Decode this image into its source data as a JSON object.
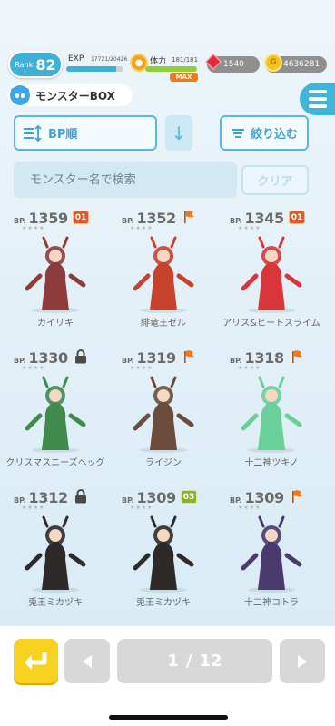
{
  "status": {
    "rank_label": "Rank",
    "rank_value": "82",
    "exp_label": "EXP",
    "exp_value": "17721/20426",
    "exp_progress": 0.87,
    "stamina_label": "体力",
    "stamina_value": "181/181",
    "stamina_progress": 1.0,
    "stamina_max_tag": "MAX",
    "gems": "1540",
    "coins": "4636281"
  },
  "header": {
    "title": "モンスターBOX",
    "menu_icon": "hamburger-icon"
  },
  "controls": {
    "sort_label": "BP順",
    "sort_direction_icon": "arrow-down-icon",
    "filter_label": "絞り込む",
    "search_placeholder": "モンスター名で検索",
    "clear_label": "クリア"
  },
  "monsters": [
    {
      "bp_label": "BP.",
      "bp": "1359",
      "badge": "01",
      "badge_type": "red",
      "name": "カイリキ",
      "color": "#8e3b3b"
    },
    {
      "bp_label": "BP.",
      "bp": "1352",
      "badge_type": "flag",
      "name": "緋竜王ゼル",
      "color": "#c6422c"
    },
    {
      "bp_label": "BP.",
      "bp": "1345",
      "badge": "01",
      "badge_type": "red",
      "name": "アリス&ヒートスライム",
      "color": "#d8363b"
    },
    {
      "bp_label": "BP.",
      "bp": "1330",
      "badge_type": "lock",
      "name": "クリスマスニーズヘッグ",
      "color": "#3f8a4c"
    },
    {
      "bp_label": "BP.",
      "bp": "1319",
      "badge_type": "flag",
      "name": "ライジン",
      "color": "#6b4c3d"
    },
    {
      "bp_label": "BP.",
      "bp": "1318",
      "badge_type": "flag",
      "name": "十二神ツキノ",
      "color": "#6bcf9a"
    },
    {
      "bp_label": "BP.",
      "bp": "1312",
      "badge_type": "lock",
      "name": "兎王ミカヅキ",
      "color": "#2f2a2a"
    },
    {
      "bp_label": "BP.",
      "bp": "1309",
      "badge": "03",
      "badge_type": "green",
      "name": "兎王ミカヅキ",
      "color": "#2f2a2a"
    },
    {
      "bp_label": "BP.",
      "bp": "1309",
      "badge_type": "flag",
      "name": "十二神コトラ",
      "color": "#4a3a6e"
    }
  ],
  "pagination": {
    "current": "1",
    "separator": "/",
    "total": "12"
  },
  "colors": {
    "accent": "#3fb0d9",
    "badge_red": "#e05a26",
    "badge_green": "#8fae34",
    "flag": "#f07a1b",
    "back_button": "#f7d21e"
  }
}
